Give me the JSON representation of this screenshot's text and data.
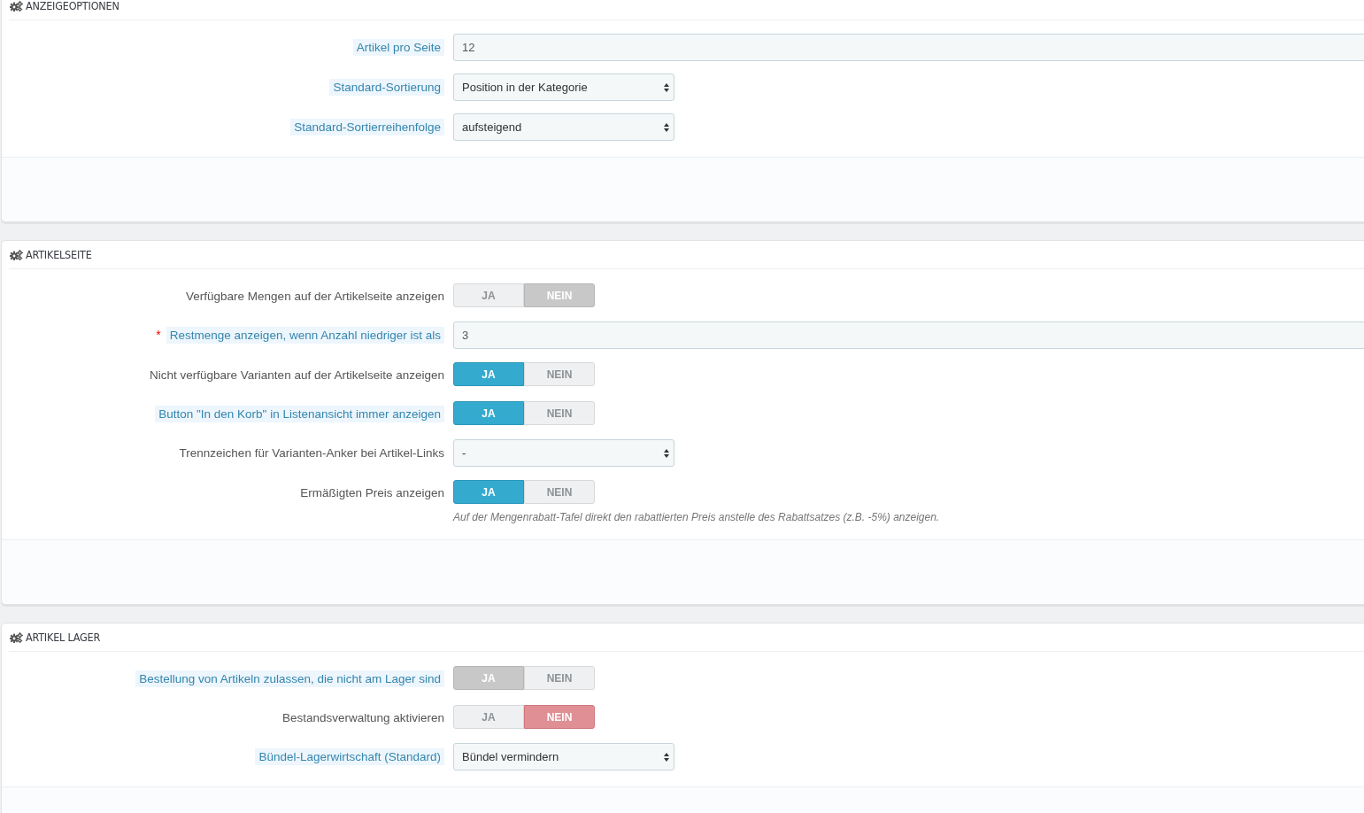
{
  "panels": [
    {
      "title": "ANZEIGEOPTIONEN",
      "fields": [
        {
          "kind": "text",
          "label": "Artikel pro Seite",
          "hint": true,
          "value": "12"
        },
        {
          "kind": "select",
          "label": "Standard-Sortierung",
          "hint": true,
          "value": "Position in der Kategorie"
        },
        {
          "kind": "select",
          "label": "Standard-Sortierreihenfolge",
          "hint": true,
          "value": "aufsteigend"
        }
      ]
    },
    {
      "title": "ARTIKELSEITE",
      "fields": [
        {
          "kind": "toggle",
          "label": "Verfügbare Mengen auf der Artikelseite anzeigen",
          "hint": false,
          "disabled": true,
          "options": [
            {
              "label": "JA",
              "selected": false
            },
            {
              "label": "NEIN",
              "selected": true
            }
          ]
        },
        {
          "kind": "text",
          "label": "Restmenge anzeigen, wenn Anzahl niedriger ist als",
          "hint": true,
          "required_mark": "*",
          "value": "3"
        },
        {
          "kind": "toggle",
          "label": "Nicht verfügbare Varianten auf der Artikelseite anzeigen",
          "hint": false,
          "disabled": false,
          "options": [
            {
              "label": "JA",
              "selected": true
            },
            {
              "label": "NEIN",
              "selected": false
            }
          ]
        },
        {
          "kind": "toggle",
          "label": "Button \"In den Korb\" in Listenansicht immer anzeigen",
          "hint": true,
          "disabled": false,
          "options": [
            {
              "label": "JA",
              "selected": true
            },
            {
              "label": "NEIN",
              "selected": false
            }
          ]
        },
        {
          "kind": "select",
          "label": "Trennzeichen für Varianten-Anker bei Artikel-Links",
          "hint": false,
          "value": "-"
        },
        {
          "kind": "toggle",
          "label": "Ermäßigten Preis anzeigen",
          "hint": false,
          "disabled": false,
          "options": [
            {
              "label": "JA",
              "selected": true
            },
            {
              "label": "NEIN",
              "selected": false
            }
          ],
          "help": "Auf der Mengenrabatt-Tafel direkt den rabattierten Preis anstelle des Rabattsatzes (z.B. -5%) anzeigen."
        }
      ]
    },
    {
      "title": "ARTIKEL LAGER",
      "fields": [
        {
          "kind": "toggle",
          "label": "Bestellung von Artikeln zulassen, die nicht am Lager sind",
          "hint": true,
          "disabled": true,
          "options": [
            {
              "label": "JA",
              "selected": true
            },
            {
              "label": "NEIN",
              "selected": false
            }
          ]
        },
        {
          "kind": "toggle",
          "label": "Bestandsverwaltung aktivieren",
          "hint": false,
          "disabled": false,
          "options": [
            {
              "label": "JA",
              "selected": false
            },
            {
              "label": "NEIN",
              "selected": true
            }
          ]
        },
        {
          "kind": "select",
          "label": "Bündel-Lagerwirtschaft (Standard)",
          "hint": true,
          "value": "Bündel vermindern"
        }
      ]
    }
  ]
}
